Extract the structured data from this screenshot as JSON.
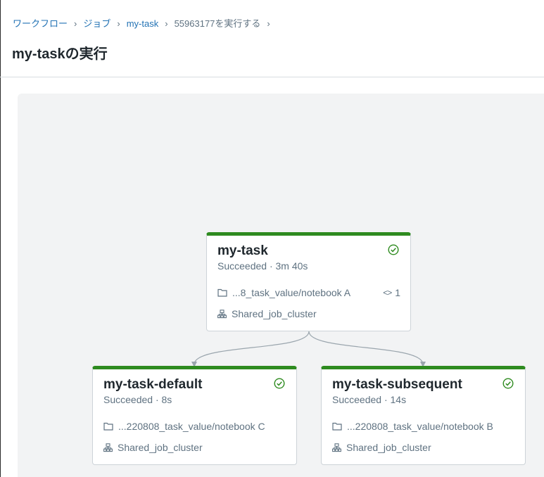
{
  "breadcrumb": {
    "items": [
      "ワークフロー",
      "ジョブ",
      "my-task",
      "55963177を実行する"
    ],
    "separator": "›"
  },
  "page": {
    "title": "my-taskの実行"
  },
  "colors": {
    "success": "#2e8b1f",
    "link": "#2272b4",
    "muted": "#5f7281"
  },
  "tasks": [
    {
      "name": "my-task",
      "status": "Succeeded · 3m 40s",
      "path": "...8_task_value/notebook A",
      "cluster": "Shared_job_cluster",
      "param_count": "1",
      "icons": [
        "check-circle-icon",
        "folder-icon",
        "code-icon",
        "cluster-icon"
      ]
    },
    {
      "name": "my-task-default",
      "status": "Succeeded · 8s",
      "path": "...220808_task_value/notebook C",
      "cluster": "Shared_job_cluster",
      "icons": [
        "check-circle-icon",
        "folder-icon",
        "cluster-icon"
      ]
    },
    {
      "name": "my-task-subsequent",
      "status": "Succeeded · 14s",
      "path": "...220808_task_value/notebook B",
      "cluster": "Shared_job_cluster",
      "icons": [
        "check-circle-icon",
        "folder-icon",
        "cluster-icon"
      ]
    }
  ]
}
